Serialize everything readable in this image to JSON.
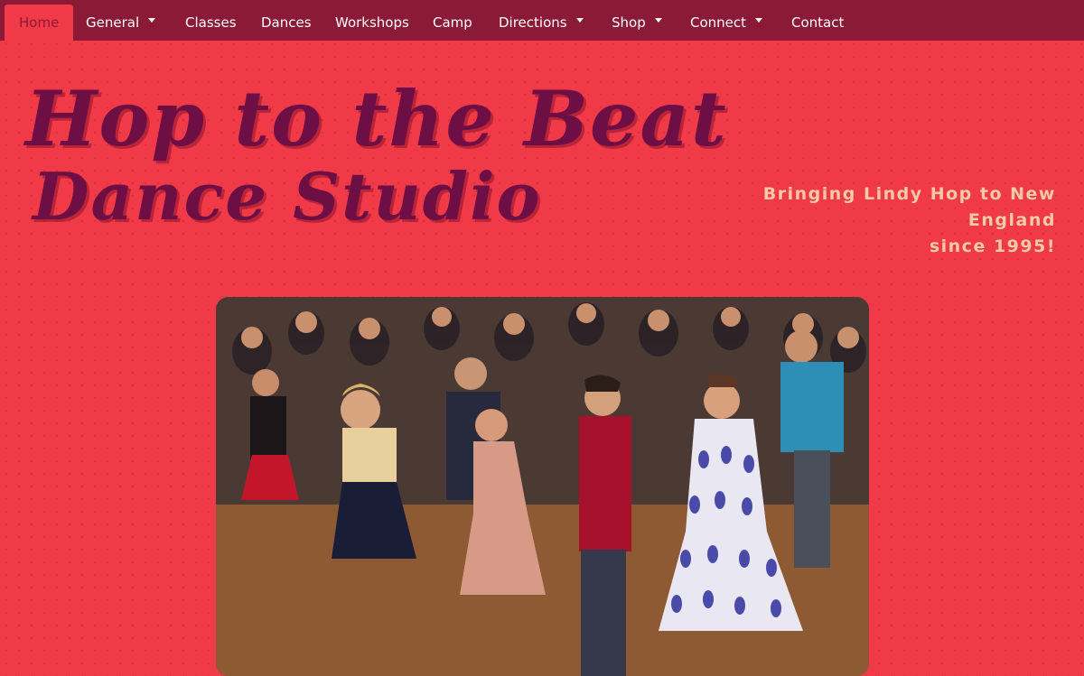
{
  "nav": {
    "items": [
      {
        "label": "Home",
        "active": true,
        "dropdown": false
      },
      {
        "label": "General",
        "active": false,
        "dropdown": true
      },
      {
        "label": "Classes",
        "active": false,
        "dropdown": false
      },
      {
        "label": "Dances",
        "active": false,
        "dropdown": false
      },
      {
        "label": "Workshops",
        "active": false,
        "dropdown": false
      },
      {
        "label": "Camp",
        "active": false,
        "dropdown": false
      },
      {
        "label": "Directions",
        "active": false,
        "dropdown": true
      },
      {
        "label": "Shop",
        "active": false,
        "dropdown": true
      },
      {
        "label": "Connect",
        "active": false,
        "dropdown": true
      },
      {
        "label": "Contact",
        "active": false,
        "dropdown": false
      }
    ]
  },
  "header": {
    "title_line1": "Hop to the Beat",
    "title_line2": "Dance Studio",
    "tagline_line1": "Bringing Lindy Hop to New England",
    "tagline_line2": "since 1995!"
  },
  "colors": {
    "page_bg": "#f03a47",
    "nav_bg": "#8b1a36",
    "title": "#6d0f44",
    "tagline": "#f6c9a9"
  }
}
